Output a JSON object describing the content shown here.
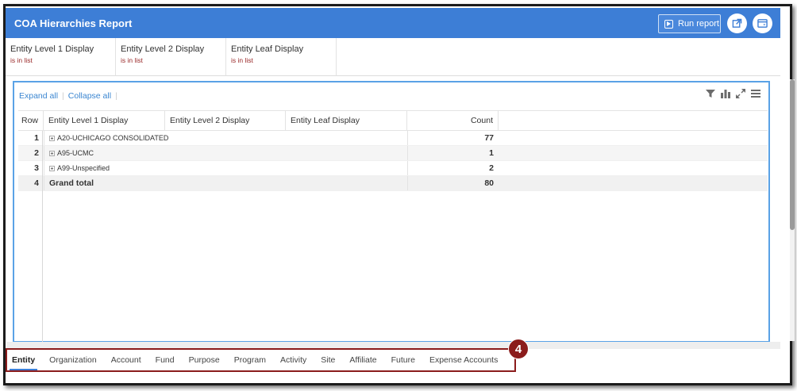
{
  "header": {
    "title": "COA Hierarchies Report",
    "run_label": "Run report",
    "accent": "#3d7ed6"
  },
  "filters": [
    {
      "label": "Entity Level 1 Display",
      "condition": "is in list"
    },
    {
      "label": "Entity Level 2 Display",
      "condition": "is in list"
    },
    {
      "label": "Entity Leaf Display",
      "condition": "is in list"
    }
  ],
  "toolbar": {
    "expand_all": "Expand all",
    "collapse_all": "Collapse all"
  },
  "table": {
    "headers": {
      "row": "Row",
      "l1": "Entity Level 1 Display",
      "l2": "Entity Level 2 Display",
      "leaf": "Entity Leaf Display",
      "count": "Count"
    },
    "rows": [
      {
        "row": "1",
        "label": "A20-UCHICAGO CONSOLIDATED",
        "count": "77"
      },
      {
        "row": "2",
        "label": "A95-UCMC",
        "count": "1"
      },
      {
        "row": "3",
        "label": "A99-Unspecified",
        "count": "2"
      }
    ],
    "total": {
      "row": "4",
      "label": "Grand total",
      "count": "80"
    }
  },
  "tabs": [
    "Entity",
    "Organization",
    "Account",
    "Fund",
    "Purpose",
    "Program",
    "Activity",
    "Site",
    "Affiliate",
    "Future",
    "Expense Accounts"
  ],
  "callout": "4",
  "icons": [
    "run-report-icon",
    "open-external-icon",
    "window-icon",
    "filter-icon",
    "chart-icon",
    "expand-icon",
    "menu-icon",
    "expand-row-icon"
  ]
}
